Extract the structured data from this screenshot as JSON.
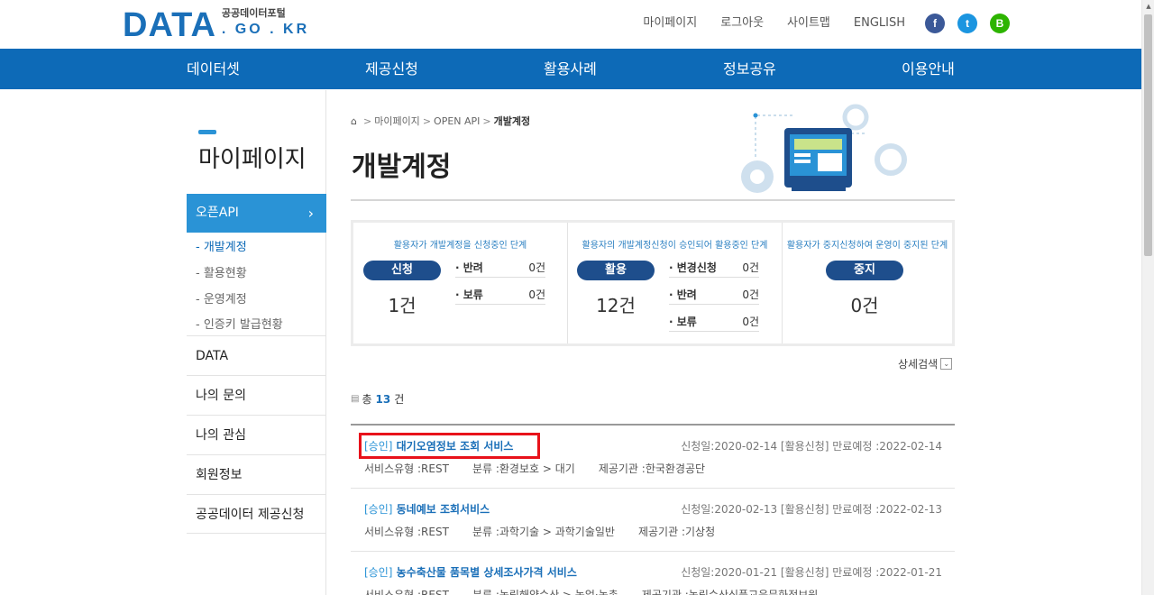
{
  "header": {
    "logo_main": "DATA",
    "logo_kr": "공공데이터포털",
    "logo_domain": ". GO . KR",
    "util_links": [
      "마이페이지",
      "로그아웃",
      "사이트맵",
      "ENGLISH"
    ],
    "sns": {
      "facebook": "f",
      "twitter": "t",
      "blog": "B"
    }
  },
  "gnb": [
    "데이터셋",
    "제공신청",
    "활용사례",
    "정보공유",
    "이용안내"
  ],
  "sidebar": {
    "title": "마이페이지",
    "active": "오픈API",
    "active_chevron": "›",
    "sub_items": [
      "- 개발계정",
      "- 활용현황",
      "- 운영계정",
      "- 인증키 발급현황"
    ],
    "items": [
      "DATA",
      "나의 문의",
      "나의 관심",
      "회원정보",
      "공공데이터 제공신청"
    ]
  },
  "breadcrumb": {
    "home": "⌂",
    "sep": ">",
    "level1": "마이페이지",
    "level2": "OPEN API",
    "current": "개발계정"
  },
  "page_title": "개발계정",
  "status": {
    "apply": {
      "desc": "활용자가 개발계정을 신청중인 단계",
      "label": "신청",
      "count": "1건",
      "subs": [
        {
          "label": "· 반려",
          "value": "0건"
        },
        {
          "label": "· 보류",
          "value": "0건"
        }
      ]
    },
    "use": {
      "desc": "활용자의 개발계정신청이 승인되어 활용중인 단계",
      "label": "활용",
      "count": "12건",
      "subs": [
        {
          "label": "· 변경신청",
          "value": "0건"
        },
        {
          "label": "· 반려",
          "value": "0건"
        },
        {
          "label": "· 보류",
          "value": "0건"
        }
      ]
    },
    "stop": {
      "desc": "활용자가 중지신청하여 운영이 중지된 단계",
      "label": "중지",
      "count": "0건"
    }
  },
  "advanced_search": {
    "label": "상세검색",
    "icon": "⌄"
  },
  "total": {
    "prefix": "총",
    "count": "13",
    "suffix": "건"
  },
  "list": [
    {
      "tag": "[승인]",
      "title": "대기오염정보 조회 서비스",
      "dates": "신청일:2020-02-14 [활용신청] 만료예정 :2022-02-14",
      "type": "서비스유형 :REST",
      "category": "분류 :환경보호 > 대기",
      "provider": "제공기관 :한국환경공단"
    },
    {
      "tag": "[승인]",
      "title": "동네예보 조회서비스",
      "dates": "신청일:2020-02-13 [활용신청] 만료예정 :2022-02-13",
      "type": "서비스유형 :REST",
      "category": "분류 :과학기술 > 과학기술일반",
      "provider": "제공기관 :기상청"
    },
    {
      "tag": "[승인]",
      "title": "농수축산물 품목별 상세조사가격 서비스",
      "dates": "신청일:2020-01-21 [활용신청] 만료예정 :2022-01-21",
      "type": "서비스유형 :REST",
      "category": "분류 :농림해양수산 > 농업·농촌",
      "provider": "제공기관 :농림수산식품교육문화정보원"
    }
  ],
  "scrollbar": {
    "up_arrow": "▲"
  },
  "colors": {
    "brand_blue": "#0d6ab7",
    "accent_blue": "#2a93d6",
    "pill_navy": "#1e4e8c",
    "highlight_red": "#e8121b"
  }
}
